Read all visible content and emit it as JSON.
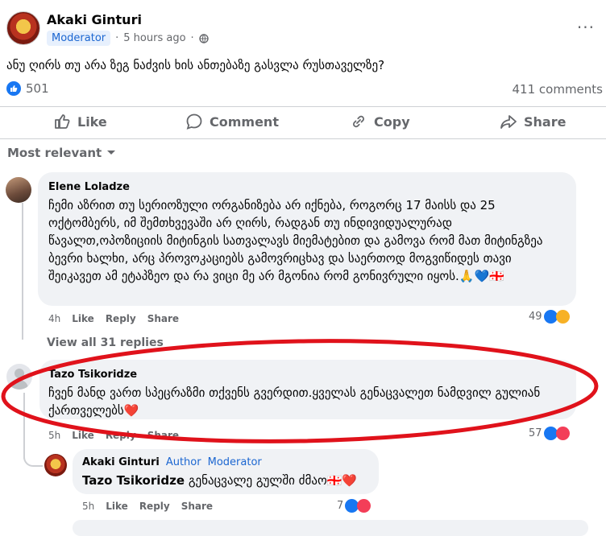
{
  "post": {
    "author": "Akaki Ginturi",
    "badge": "Moderator",
    "time": "5 hours ago",
    "text": "ანუ ღირს თუ არა ზეგ ნაძვის ხის ანთებაზე გასვლა რუსთაველზე?",
    "likes": "501",
    "comments": "411 comments"
  },
  "actions": {
    "like": "Like",
    "comment": "Comment",
    "copy": "Copy",
    "share": "Share"
  },
  "sort": {
    "label": "Most relevant"
  },
  "comments": [
    {
      "name": "Elene Loladze",
      "text": "ჩემი აზრით თუ სერიოზული ორგანიზება არ იქნება, როგორც 17 მაისს და 25 ოქტომბერს, იმ შემთხვევაში არ ღირს, რადგან თუ ინდივიდუალურად წავალთ,ოპოზიციის მიტინგის სათვალავს მიემატებით და გამოვა რომ მათ მიტინგზეა ბევრი ხალხი, არც პროვოკაციებს გამოვრიცხავ და საერთოდ მოგვიწიდეს თავი შეიკავეთ ამ ეტაპზეო და რა ვიცი მე არ მგონია რომ გონივრული იყოს.🙏💙🇬🇪",
      "time": "4h",
      "like": "Like",
      "reply": "Reply",
      "share": "Share",
      "reactions": "49"
    },
    {
      "name": "Tazo Tsikoridze",
      "text": "ჩვენ მანდ ვართ სპეცრაზმი თქვენს გვერდით.ყველას გენაცვალეთ ნამდვილ გულიან ქართველებს❤️",
      "time": "5h",
      "like": "Like",
      "reply": "Reply",
      "share": "Share",
      "reactions": "57"
    }
  ],
  "view_replies": "View all 31 replies",
  "reply": {
    "name": "Akaki Ginturi",
    "author_badge": "Author",
    "mod_badge": "Moderator",
    "mention": "Tazo Tsikoridze",
    "text": "გენაცვალე გულში ძმაო🇬🇪❤️",
    "time": "5h",
    "like": "Like",
    "reply": "Reply",
    "share": "Share",
    "reactions": "7"
  },
  "colors": {
    "accent": "#1877f2",
    "annotation": "#e0121b"
  }
}
